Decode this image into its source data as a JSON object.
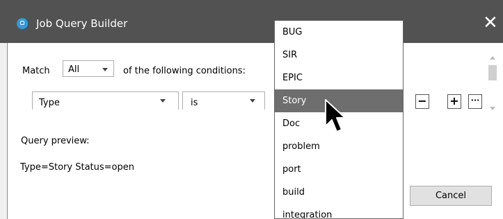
{
  "window": {
    "title": "Job Query Builder",
    "close_glyph": "✕"
  },
  "match": {
    "label": "Match",
    "value": "All",
    "suffix": "of the following conditions:"
  },
  "condition": {
    "field": "Type",
    "operator": "is"
  },
  "row_buttons": {
    "remove": "−",
    "add": "+",
    "more": "···"
  },
  "preview": {
    "label": "Query preview:",
    "text": "Type=Story Status=open"
  },
  "buttons": {
    "cancel": "Cancel"
  },
  "dropdown": {
    "items": [
      "BUG",
      "SIR",
      "EPIC",
      "Story",
      "Doc",
      "problem",
      "port",
      "build",
      "integration"
    ],
    "selected": "Story"
  },
  "colors": {
    "titlebar": "#525252",
    "app_icon": "#2d9be0",
    "selected_item": "#6e6e6e"
  },
  "icons": {
    "app": "app-logo-icon",
    "close": "close-icon",
    "cursor": "mouse-pointer-icon"
  }
}
